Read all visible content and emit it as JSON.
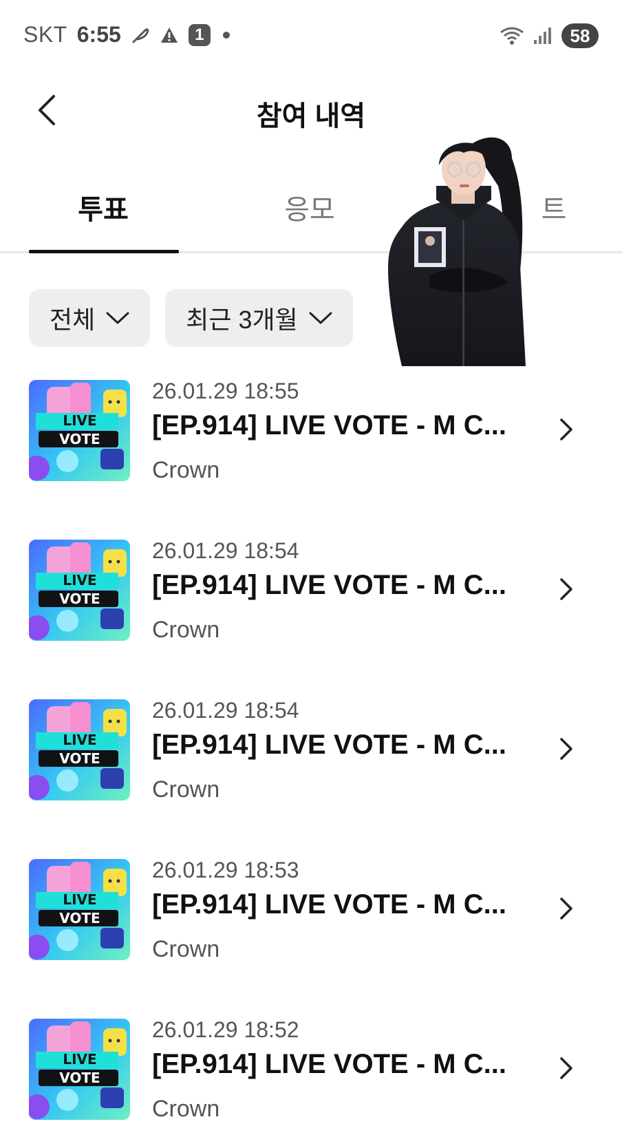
{
  "status_bar": {
    "carrier": "SKT",
    "time": "6:55",
    "notification_count": "1",
    "battery": "58",
    "icons": [
      "feather-icon",
      "warning-icon",
      "notification-badge",
      "dot-icon",
      "wifi-icon",
      "signal-icon",
      "battery-icon"
    ]
  },
  "header": {
    "title": "참여 내역",
    "back_icon": "chevron-left-icon"
  },
  "tabs": [
    {
      "label": "투표",
      "active": true
    },
    {
      "label": "응모",
      "active": false
    },
    {
      "label": "트",
      "active": false
    }
  ],
  "filters": {
    "type": {
      "label": "전체",
      "icon": "chevron-down-icon"
    },
    "period": {
      "label": "최근 3개월",
      "icon": "chevron-down-icon"
    }
  },
  "items": [
    {
      "date": "26.01.29 18:55",
      "title": "[EP.914] LIVE VOTE - M C...",
      "subtitle": "Crown",
      "thumb_text_1": "LIVE",
      "thumb_text_2": "VOTE"
    },
    {
      "date": "26.01.29 18:54",
      "title": "[EP.914] LIVE VOTE - M C...",
      "subtitle": "Crown",
      "thumb_text_1": "LIVE",
      "thumb_text_2": "VOTE"
    },
    {
      "date": "26.01.29 18:54",
      "title": "[EP.914] LIVE VOTE - M C...",
      "subtitle": "Crown",
      "thumb_text_1": "LIVE",
      "thumb_text_2": "VOTE"
    },
    {
      "date": "26.01.29 18:53",
      "title": "[EP.914] LIVE VOTE - M C...",
      "subtitle": "Crown",
      "thumb_text_1": "LIVE",
      "thumb_text_2": "VOTE"
    },
    {
      "date": "26.01.29 18:52",
      "title": "[EP.914] LIVE VOTE - M C...",
      "subtitle": "Crown",
      "thumb_text_1": "LIVE",
      "thumb_text_2": "VOTE"
    }
  ],
  "colors": {
    "active_tab": "#111111",
    "inactive_tab": "#777777",
    "chip_bg": "#eeeeef"
  }
}
